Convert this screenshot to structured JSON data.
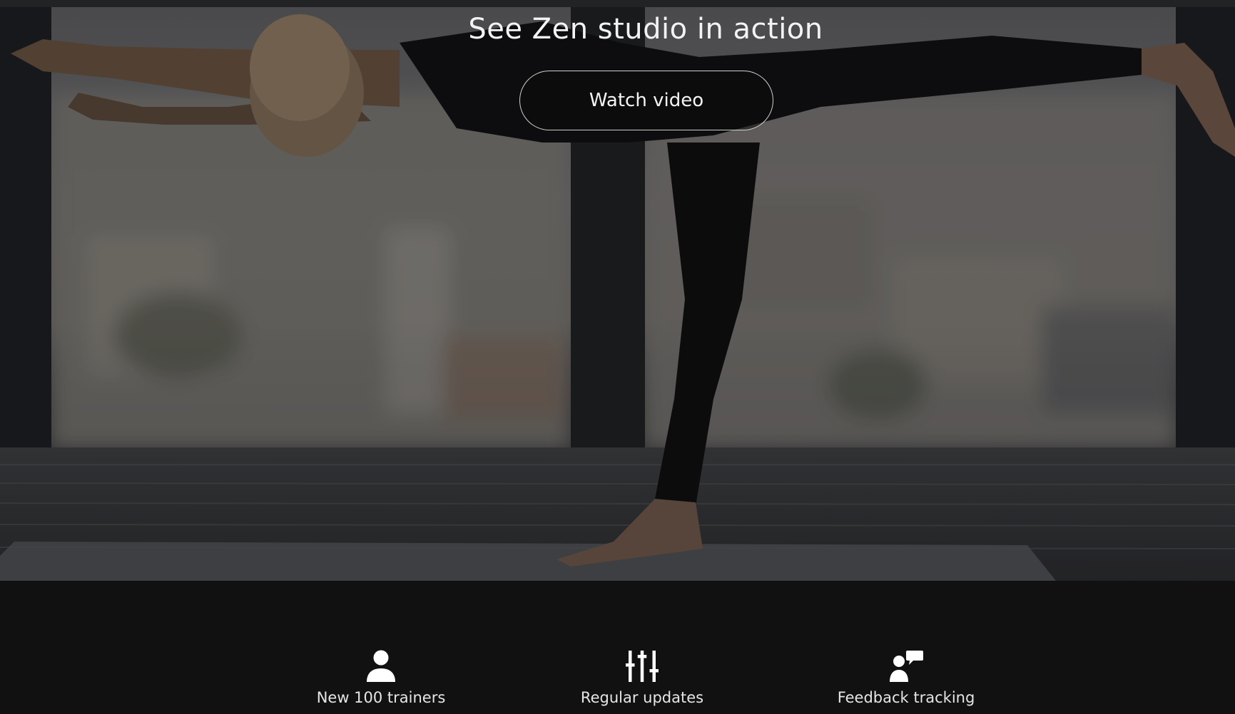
{
  "hero": {
    "title": "See Zen studio in action",
    "button_label": "Watch video"
  },
  "features": [
    {
      "icon": "user-icon",
      "label": "New 100 trainers"
    },
    {
      "icon": "sliders-icon",
      "label": "Regular updates"
    },
    {
      "icon": "user-chat-icon",
      "label": "Feedback tracking"
    }
  ],
  "colors": {
    "background": "#111111",
    "text": "#ffffff"
  }
}
